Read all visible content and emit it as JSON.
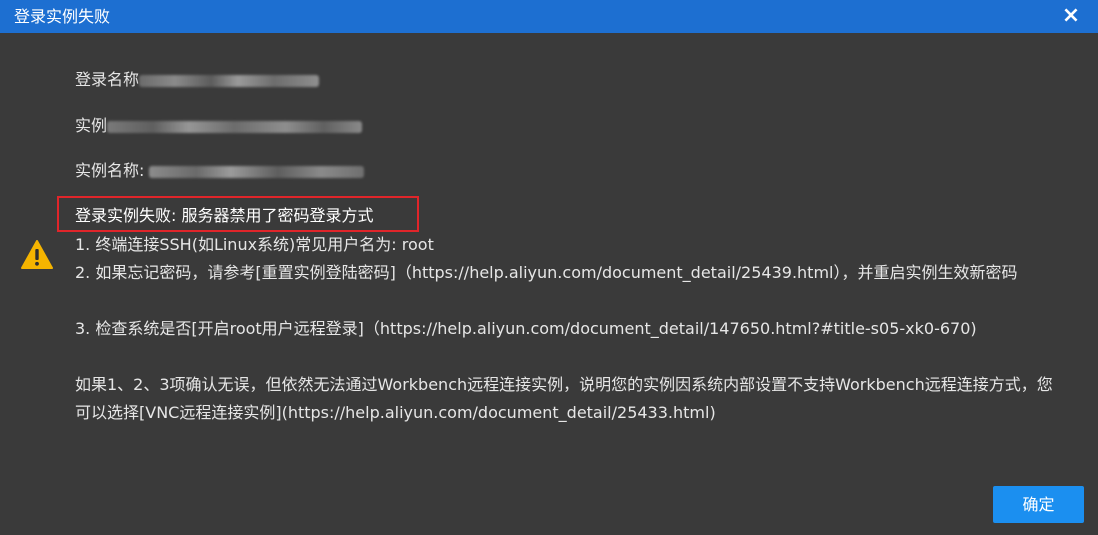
{
  "dialog": {
    "title": "登录实例失败",
    "close_label": "×",
    "icons": {
      "close": "close-icon",
      "warning": "warning-icon"
    },
    "fields": {
      "login_name_label": "登录名称",
      "instance_label": "实例",
      "instance_name_label": "实例名称: "
    },
    "error_title": "登录实例失败: 服务器禁用了密码登录方式",
    "steps": [
      "1. 终端连接SSH(如Linux系统)常见用户名为: root",
      "2. 如果忘记密码，请参考[重置实例登陆密码]（https://help.aliyun.com/document_detail/25439.html），并重启实例生效新密码",
      "3. 检查系统是否[开启root用户远程登录]（https://help.aliyun.com/document_detail/147650.html?#title-s05-xk0-670)"
    ],
    "note": "如果1、2、3项确认无误，但依然无法通过Workbench远程连接实例，说明您的实例因系统内部设置不支持Workbench远程连接方式，您可以选择[VNC远程连接实例](https://help.aliyun.com/document_detail/25433.html)",
    "confirm_label": "确定",
    "colors": {
      "titlebar": "#1d6fd1",
      "background": "#3a3a3a",
      "error_border": "#e0252a",
      "button": "#1b8ff0",
      "warning": "#f5b400"
    }
  }
}
